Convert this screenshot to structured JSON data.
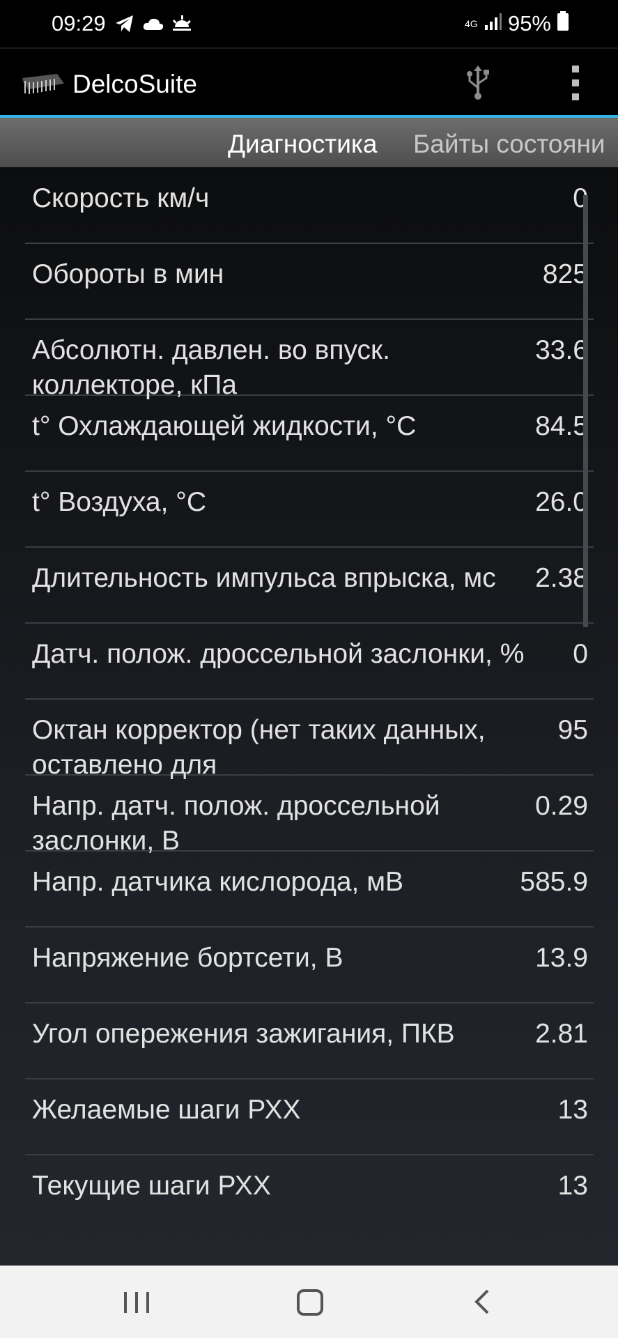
{
  "status_bar": {
    "time": "09:29",
    "network": "4G",
    "battery": "95%",
    "icons_left": [
      "telegram-icon",
      "cloud-icon",
      "sunrise-icon"
    ],
    "icons_right": [
      "network-4g-icon",
      "signal-icon",
      "battery-icon"
    ]
  },
  "app_bar": {
    "title": "DelcoSuite",
    "icons": [
      "chip-logo-icon",
      "usb-icon",
      "overflow-menu-icon"
    ]
  },
  "tabs": [
    {
      "label": "Диагностика",
      "active": true
    },
    {
      "label": "Байты состояни",
      "active": false
    }
  ],
  "rows": [
    {
      "label": "Скорость км/ч",
      "value": "0"
    },
    {
      "label": "Обороты в мин",
      "value": "825"
    },
    {
      "label": "Абсолютн. давлен. во впуск. коллекторе, кПа",
      "value": "33.6"
    },
    {
      "label": "t° Охлаждающей жидкости, °С",
      "value": "84.5"
    },
    {
      "label": "t° Воздуха, °С",
      "value": "26.0"
    },
    {
      "label": "Длительность импульса впрыска, мс",
      "value": "2.38"
    },
    {
      "label": "Датч. полож. дроссельной заслонки, %",
      "value": "0"
    },
    {
      "label": "Октан корректор (нет таких данных, оставлено для",
      "value": "95"
    },
    {
      "label": "Напр. датч. полож. дроссельной заслонки, В",
      "value": "0.29"
    },
    {
      "label": "Напр. датчика кислорода, мВ",
      "value": "585.9"
    },
    {
      "label": "Напряжение бортсети, В",
      "value": "13.9"
    },
    {
      "label": "Угол опережения зажигания, ПКВ",
      "value": "2.81"
    },
    {
      "label": "Желаемые шаги РХХ",
      "value": "13"
    },
    {
      "label": "Текущие шаги РХХ",
      "value": "13"
    }
  ],
  "colors": {
    "accent": "#33b5e5",
    "text": "#e2e2e2",
    "divider": "#3a3d42"
  }
}
